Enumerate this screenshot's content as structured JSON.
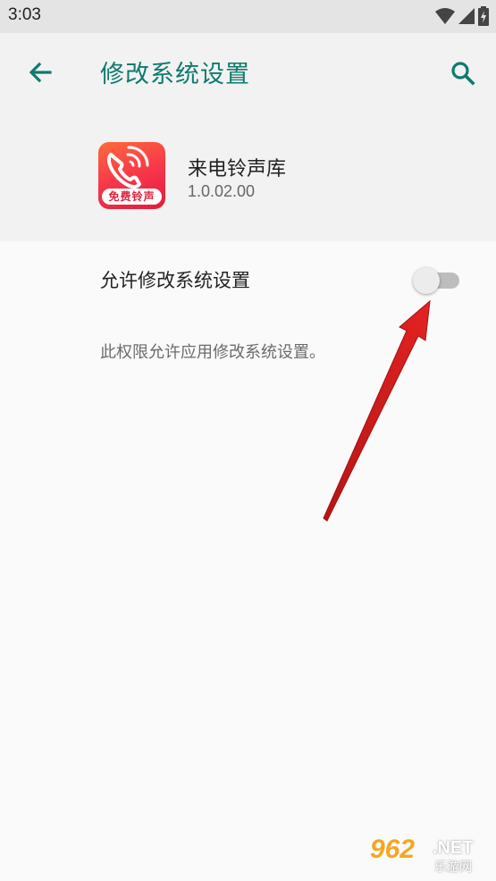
{
  "status_bar": {
    "time": "3:03",
    "icons": [
      "wifi-icon",
      "signal-icon",
      "battery-icon"
    ]
  },
  "toolbar": {
    "title": "修改系统设置",
    "back_icon": "arrow-back-icon",
    "search_icon": "search-icon"
  },
  "app": {
    "name": "来电铃声库",
    "version": "1.0.02.00",
    "icon_badge": "免费铃声"
  },
  "setting": {
    "label": "允许修改系统设置",
    "enabled": false,
    "description": "此权限允许应用修改系统设置。"
  },
  "watermark": {
    "main": "962",
    "suffix": ".NET",
    "sub": "乐游网"
  },
  "colors": {
    "accent": "#0f7a6f",
    "annotation_arrow": "#d81e1e",
    "header_bg": "#f2f2f2",
    "status_bg": "#e4e4e4"
  }
}
